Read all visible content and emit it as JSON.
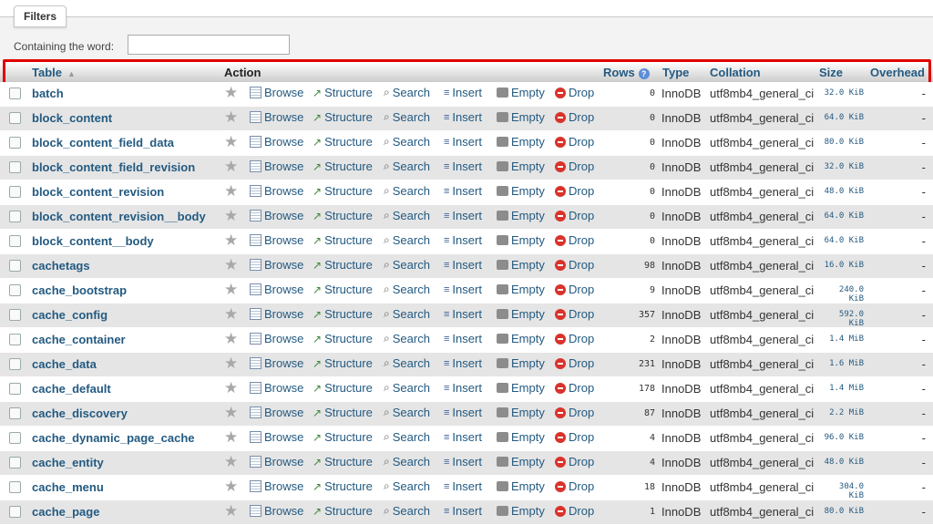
{
  "filters": {
    "legend": "Filters",
    "label": "Containing the word:",
    "value": ""
  },
  "header": {
    "table": "Table",
    "action": "Action",
    "rows": "Rows",
    "type": "Type",
    "collation": "Collation",
    "size": "Size",
    "overhead": "Overhead"
  },
  "actions": {
    "browse": "Browse",
    "structure": "Structure",
    "search": "Search",
    "insert": "Insert",
    "empty": "Empty",
    "drop": "Drop"
  },
  "icons": {
    "favorite": "star-icon",
    "browse": "browse-icon",
    "structure": "structure-icon",
    "search": "search-icon",
    "insert": "insert-icon",
    "empty": "empty-icon",
    "drop": "drop-icon",
    "sort": "sort-ascending-icon",
    "rows_info": "info-icon"
  },
  "colors": {
    "link": "#235a81",
    "highlight": "#e00000",
    "row_alt": "#e5e5e5",
    "drop": "#d9332b"
  },
  "tables": [
    {
      "name": "batch",
      "rows": "0",
      "type": "InnoDB",
      "collation": "utf8mb4_general_ci",
      "size": "32.0 KiB",
      "overhead": "-"
    },
    {
      "name": "block_content",
      "rows": "0",
      "type": "InnoDB",
      "collation": "utf8mb4_general_ci",
      "size": "64.0 KiB",
      "overhead": "-"
    },
    {
      "name": "block_content_field_data",
      "rows": "0",
      "type": "InnoDB",
      "collation": "utf8mb4_general_ci",
      "size": "80.0 KiB",
      "overhead": "-"
    },
    {
      "name": "block_content_field_revision",
      "rows": "0",
      "type": "InnoDB",
      "collation": "utf8mb4_general_ci",
      "size": "32.0 KiB",
      "overhead": "-"
    },
    {
      "name": "block_content_revision",
      "rows": "0",
      "type": "InnoDB",
      "collation": "utf8mb4_general_ci",
      "size": "48.0 KiB",
      "overhead": "-"
    },
    {
      "name": "block_content_revision__body",
      "rows": "0",
      "type": "InnoDB",
      "collation": "utf8mb4_general_ci",
      "size": "64.0 KiB",
      "overhead": "-"
    },
    {
      "name": "block_content__body",
      "rows": "0",
      "type": "InnoDB",
      "collation": "utf8mb4_general_ci",
      "size": "64.0 KiB",
      "overhead": "-"
    },
    {
      "name": "cachetags",
      "rows": "98",
      "type": "InnoDB",
      "collation": "utf8mb4_general_ci",
      "size": "16.0 KiB",
      "overhead": "-"
    },
    {
      "name": "cache_bootstrap",
      "rows": "9",
      "type": "InnoDB",
      "collation": "utf8mb4_general_ci",
      "size": "240.0 KiB",
      "overhead": "-"
    },
    {
      "name": "cache_config",
      "rows": "357",
      "type": "InnoDB",
      "collation": "utf8mb4_general_ci",
      "size": "592.0 KiB",
      "overhead": "-"
    },
    {
      "name": "cache_container",
      "rows": "2",
      "type": "InnoDB",
      "collation": "utf8mb4_general_ci",
      "size": "1.4 MiB",
      "overhead": "-"
    },
    {
      "name": "cache_data",
      "rows": "231",
      "type": "InnoDB",
      "collation": "utf8mb4_general_ci",
      "size": "1.6 MiB",
      "overhead": "-"
    },
    {
      "name": "cache_default",
      "rows": "178",
      "type": "InnoDB",
      "collation": "utf8mb4_general_ci",
      "size": "1.4 MiB",
      "overhead": "-"
    },
    {
      "name": "cache_discovery",
      "rows": "87",
      "type": "InnoDB",
      "collation": "utf8mb4_general_ci",
      "size": "2.2 MiB",
      "overhead": "-"
    },
    {
      "name": "cache_dynamic_page_cache",
      "rows": "4",
      "type": "InnoDB",
      "collation": "utf8mb4_general_ci",
      "size": "96.0 KiB",
      "overhead": "-"
    },
    {
      "name": "cache_entity",
      "rows": "4",
      "type": "InnoDB",
      "collation": "utf8mb4_general_ci",
      "size": "48.0 KiB",
      "overhead": "-"
    },
    {
      "name": "cache_menu",
      "rows": "18",
      "type": "InnoDB",
      "collation": "utf8mb4_general_ci",
      "size": "304.0 KiB",
      "overhead": "-"
    },
    {
      "name": "cache_page",
      "rows": "1",
      "type": "InnoDB",
      "collation": "utf8mb4_general_ci",
      "size": "80.0 KiB",
      "overhead": "-"
    }
  ]
}
